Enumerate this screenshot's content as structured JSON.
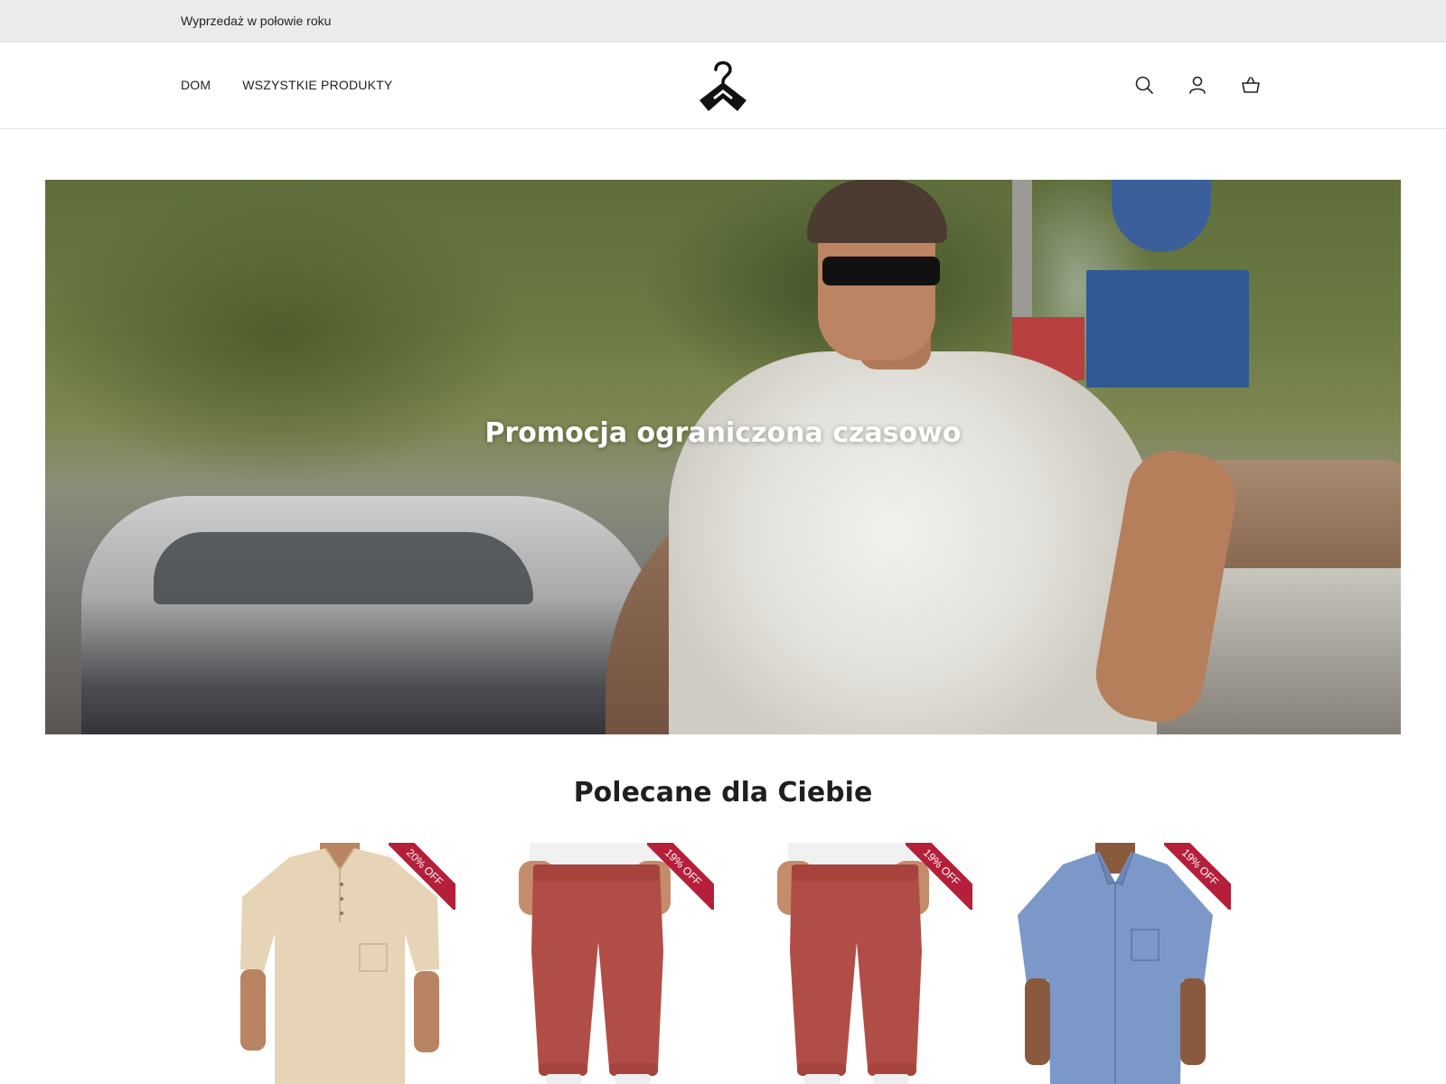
{
  "announcement": {
    "text": "Wyprzedaż w połowie roku"
  },
  "nav": {
    "items": [
      {
        "label": "DOM"
      },
      {
        "label": "WSZYSTKIE PRODUKTY"
      }
    ]
  },
  "header_icons": [
    "search-icon",
    "account-icon",
    "cart-icon"
  ],
  "hero": {
    "title": "Promocja ograniczona czasowo"
  },
  "featured": {
    "title": "Polecane dla Ciebie",
    "products": [
      {
        "badge": "20% OFF",
        "image": "beige-henley-shirt"
      },
      {
        "badge": "19% OFF",
        "image": "red-sweatpants"
      },
      {
        "badge": "19% OFF",
        "image": "red-sweatpants"
      },
      {
        "badge": "19% OFF",
        "image": "blue-short-sleeve-shirt"
      }
    ]
  },
  "colors": {
    "badge": "#b51f3a",
    "announcement_bg": "#ebebeb"
  }
}
